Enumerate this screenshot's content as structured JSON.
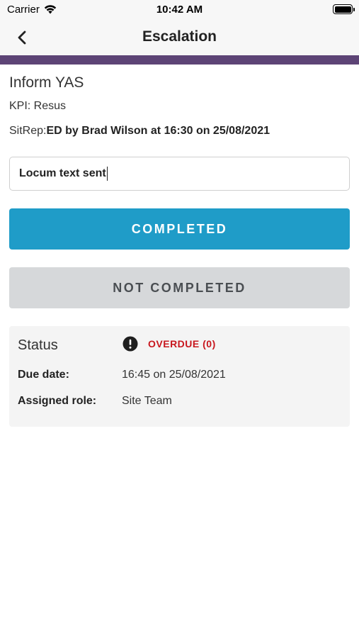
{
  "status_bar": {
    "carrier": "Carrier",
    "time": "10:42 AM"
  },
  "nav": {
    "title": "Escalation",
    "back_icon": "chevron-left-icon"
  },
  "colors": {
    "accent_stripe": "#5d4476",
    "completed_button": "#1f9cc8",
    "not_completed_button": "#d6d8da",
    "overdue_text": "#c8171e"
  },
  "task": {
    "title": "Inform YAS",
    "kpi": "KPI: Resus",
    "sitrep_label": "SitRep:",
    "sitrep_value": "ED by Brad Wilson at 16:30 on 25/08/2021"
  },
  "note_input": {
    "value": "Locum text sent"
  },
  "buttons": {
    "completed": "COMPLETED",
    "not_completed": "NOT COMPLETED"
  },
  "status_card": {
    "status_label": "Status",
    "status_icon": "exclamation-circle-icon",
    "status_value": "OVERDUE (0)",
    "due_date_label": "Due date:",
    "due_date_value": "16:45 on 25/08/2021",
    "assigned_role_label": "Assigned role:",
    "assigned_role_value": "Site Team"
  }
}
